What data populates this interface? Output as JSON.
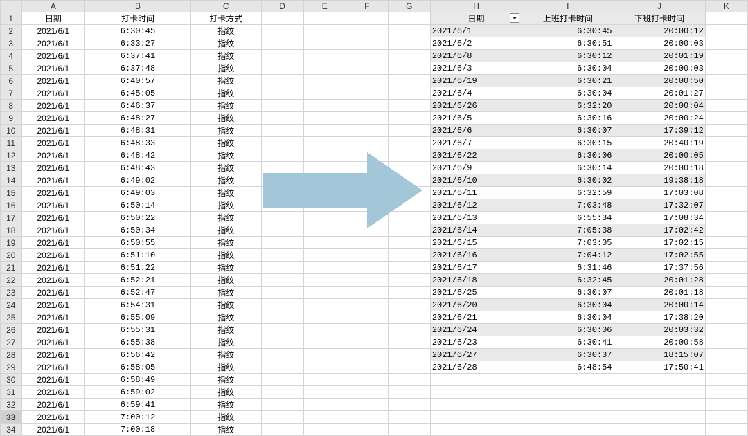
{
  "columns": [
    "A",
    "B",
    "C",
    "D",
    "E",
    "F",
    "G",
    "H",
    "I",
    "J",
    "K"
  ],
  "row_count": 34,
  "selected_row": 33,
  "left_headers": {
    "A": "日期",
    "B": "打卡时间",
    "C": "打卡方式"
  },
  "left_rows": [
    [
      "2021/6/1",
      "6:30:45",
      "指纹"
    ],
    [
      "2021/6/1",
      "6:33:27",
      "指纹"
    ],
    [
      "2021/6/1",
      "6:37:41",
      "指纹"
    ],
    [
      "2021/6/1",
      "6:37:48",
      "指纹"
    ],
    [
      "2021/6/1",
      "6:40:57",
      "指纹"
    ],
    [
      "2021/6/1",
      "6:45:05",
      "指纹"
    ],
    [
      "2021/6/1",
      "6:46:37",
      "指纹"
    ],
    [
      "2021/6/1",
      "6:48:27",
      "指纹"
    ],
    [
      "2021/6/1",
      "6:48:31",
      "指纹"
    ],
    [
      "2021/6/1",
      "6:48:33",
      "指纹"
    ],
    [
      "2021/6/1",
      "6:48:42",
      "指纹"
    ],
    [
      "2021/6/1",
      "6:48:43",
      "指纹"
    ],
    [
      "2021/6/1",
      "6:49:02",
      "指纹"
    ],
    [
      "2021/6/1",
      "6:49:03",
      "指纹"
    ],
    [
      "2021/6/1",
      "6:50:14",
      "指纹"
    ],
    [
      "2021/6/1",
      "6:50:22",
      "指纹"
    ],
    [
      "2021/6/1",
      "6:50:34",
      "指纹"
    ],
    [
      "2021/6/1",
      "6:50:55",
      "指纹"
    ],
    [
      "2021/6/1",
      "6:51:10",
      "指纹"
    ],
    [
      "2021/6/1",
      "6:51:22",
      "指纹"
    ],
    [
      "2021/6/1",
      "6:52:21",
      "指纹"
    ],
    [
      "2021/6/1",
      "6:52:47",
      "指纹"
    ],
    [
      "2021/6/1",
      "6:54:31",
      "指纹"
    ],
    [
      "2021/6/1",
      "6:55:09",
      "指纹"
    ],
    [
      "2021/6/1",
      "6:55:31",
      "指纹"
    ],
    [
      "2021/6/1",
      "6:55:38",
      "指纹"
    ],
    [
      "2021/6/1",
      "6:56:42",
      "指纹"
    ],
    [
      "2021/6/1",
      "6:58:05",
      "指纹"
    ],
    [
      "2021/6/1",
      "6:58:49",
      "指纹"
    ],
    [
      "2021/6/1",
      "6:59:02",
      "指纹"
    ],
    [
      "2021/6/1",
      "6:59:41",
      "指纹"
    ],
    [
      "2021/6/1",
      "7:00:12",
      "指纹"
    ],
    [
      "2021/6/1",
      "7:00:18",
      "指纹"
    ]
  ],
  "right_headers": {
    "H": "日期",
    "I": "上班打卡时间",
    "J": "下班打卡时间"
  },
  "right_rows": [
    [
      "2021/6/1",
      "6:30:45",
      "20:00:12"
    ],
    [
      "2021/6/2",
      "6:30:51",
      "20:00:03"
    ],
    [
      "2021/6/8",
      "6:30:12",
      "20:01:19"
    ],
    [
      "2021/6/3",
      "6:30:04",
      "20:00:03"
    ],
    [
      "2021/6/19",
      "6:30:21",
      "20:00:50"
    ],
    [
      "2021/6/4",
      "6:30:04",
      "20:01:27"
    ],
    [
      "2021/6/26",
      "6:32:20",
      "20:00:04"
    ],
    [
      "2021/6/5",
      "6:30:16",
      "20:00:24"
    ],
    [
      "2021/6/6",
      "6:30:07",
      "17:39:12"
    ],
    [
      "2021/6/7",
      "6:30:15",
      "20:40:19"
    ],
    [
      "2021/6/22",
      "6:30:06",
      "20:00:05"
    ],
    [
      "2021/6/9",
      "6:30:14",
      "20:00:18"
    ],
    [
      "2021/6/10",
      "6:30:02",
      "19:38:18"
    ],
    [
      "2021/6/11",
      "6:32:59",
      "17:03:08"
    ],
    [
      "2021/6/12",
      "7:03:48",
      "17:32:07"
    ],
    [
      "2021/6/13",
      "6:55:34",
      "17:08:34"
    ],
    [
      "2021/6/14",
      "7:05:38",
      "17:02:42"
    ],
    [
      "2021/6/15",
      "7:03:05",
      "17:02:15"
    ],
    [
      "2021/6/16",
      "7:04:12",
      "17:02:55"
    ],
    [
      "2021/6/17",
      "6:31:46",
      "17:37:56"
    ],
    [
      "2021/6/18",
      "6:32:45",
      "20:01:28"
    ],
    [
      "2021/6/25",
      "6:30:07",
      "20:01:18"
    ],
    [
      "2021/6/20",
      "6:30:04",
      "20:00:14"
    ],
    [
      "2021/6/21",
      "6:30:04",
      "17:38:20"
    ],
    [
      "2021/6/24",
      "6:30:06",
      "20:03:32"
    ],
    [
      "2021/6/23",
      "6:30:41",
      "20:00:58"
    ],
    [
      "2021/6/27",
      "6:30:37",
      "18:15:07"
    ],
    [
      "2021/6/28",
      "6:48:54",
      "17:50:41"
    ]
  ],
  "arrow_color": "#a3c6d8"
}
